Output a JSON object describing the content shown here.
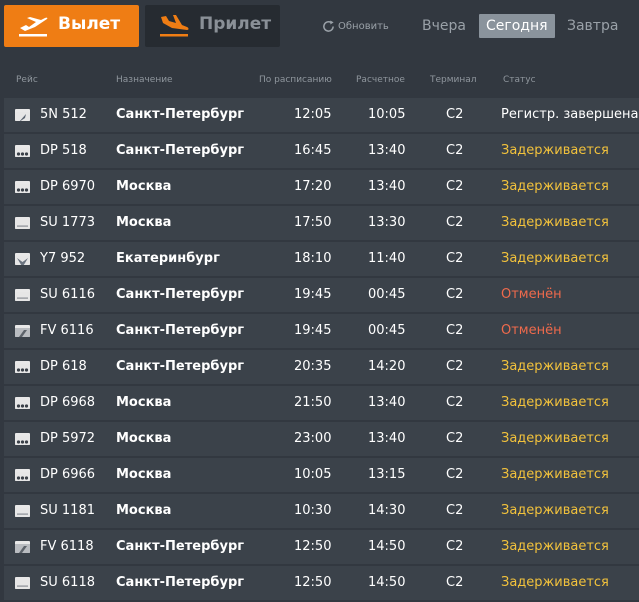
{
  "tabs": {
    "departures": "Вылет",
    "arrivals": "Прилет"
  },
  "refresh_label": "Обновить",
  "days": {
    "yesterday": "Вчера",
    "today": "Сегодня",
    "tomorrow": "Завтра"
  },
  "columns": {
    "flight": "Рейс",
    "destination": "Назначение",
    "scheduled": "По расписанию",
    "estimated": "Расчетное",
    "terminal": "Терминал",
    "status": "Статус"
  },
  "colors": {
    "accent": "#ef7d14",
    "delayed": "#f2c23c",
    "cancelled": "#ef6a4c"
  },
  "flights": [
    {
      "logo": "airline-5n-logo",
      "flight": "5N 512",
      "destination": "Санкт-Петербург",
      "scheduled": "12:05",
      "estimated": "10:05",
      "terminal": "C2",
      "status": "Регистр. завершена",
      "status_type": "done"
    },
    {
      "logo": "airline-dp-logo",
      "flight": "DP 518",
      "destination": "Санкт-Петербург",
      "scheduled": "16:45",
      "estimated": "13:40",
      "terminal": "C2",
      "status": "Задерживается",
      "status_type": "delay"
    },
    {
      "logo": "airline-dp-logo",
      "flight": "DP 6970",
      "destination": "Москва",
      "scheduled": "17:20",
      "estimated": "13:40",
      "terminal": "C2",
      "status": "Задерживается",
      "status_type": "delay"
    },
    {
      "logo": "airline-su-logo",
      "flight": "SU 1773",
      "destination": "Москва",
      "scheduled": "17:50",
      "estimated": "13:30",
      "terminal": "C2",
      "status": "Задерживается",
      "status_type": "delay"
    },
    {
      "logo": "airline-y7-logo",
      "flight": "Y7 952",
      "destination": "Екатеринбург",
      "scheduled": "18:10",
      "estimated": "11:40",
      "terminal": "C2",
      "status": "Задерживается",
      "status_type": "delay"
    },
    {
      "logo": "airline-su-logo",
      "flight": "SU 6116",
      "destination": "Санкт-Петербург",
      "scheduled": "19:45",
      "estimated": "00:45",
      "terminal": "C2",
      "status": "Отменён",
      "status_type": "cancel"
    },
    {
      "logo": "airline-fv-logo",
      "flight": "FV 6116",
      "destination": "Санкт-Петербург",
      "scheduled": "19:45",
      "estimated": "00:45",
      "terminal": "C2",
      "status": "Отменён",
      "status_type": "cancel"
    },
    {
      "logo": "airline-dp-logo",
      "flight": "DP 618",
      "destination": "Санкт-Петербург",
      "scheduled": "20:35",
      "estimated": "14:20",
      "terminal": "C2",
      "status": "Задерживается",
      "status_type": "delay"
    },
    {
      "logo": "airline-dp-logo",
      "flight": "DP 6968",
      "destination": "Москва",
      "scheduled": "21:50",
      "estimated": "13:40",
      "terminal": "C2",
      "status": "Задерживается",
      "status_type": "delay"
    },
    {
      "logo": "airline-dp-logo",
      "flight": "DP 5972",
      "destination": "Москва",
      "scheduled": "23:00",
      "estimated": "13:40",
      "terminal": "C2",
      "status": "Задерживается",
      "status_type": "delay"
    },
    {
      "logo": "airline-dp-logo",
      "flight": "DP 6966",
      "destination": "Москва",
      "scheduled": "10:05",
      "estimated": "13:15",
      "terminal": "C2",
      "status": "Задерживается",
      "status_type": "delay"
    },
    {
      "logo": "airline-su-logo",
      "flight": "SU 1181",
      "destination": "Москва",
      "scheduled": "10:30",
      "estimated": "14:30",
      "terminal": "C2",
      "status": "Задерживается",
      "status_type": "delay"
    },
    {
      "logo": "airline-fv-logo",
      "flight": "FV 6118",
      "destination": "Санкт-Петербург",
      "scheduled": "12:50",
      "estimated": "14:50",
      "terminal": "C2",
      "status": "Задерживается",
      "status_type": "delay"
    },
    {
      "logo": "airline-su-logo",
      "flight": "SU 6118",
      "destination": "Санкт-Петербург",
      "scheduled": "12:50",
      "estimated": "14:50",
      "terminal": "C2",
      "status": "Задерживается",
      "status_type": "delay"
    }
  ]
}
